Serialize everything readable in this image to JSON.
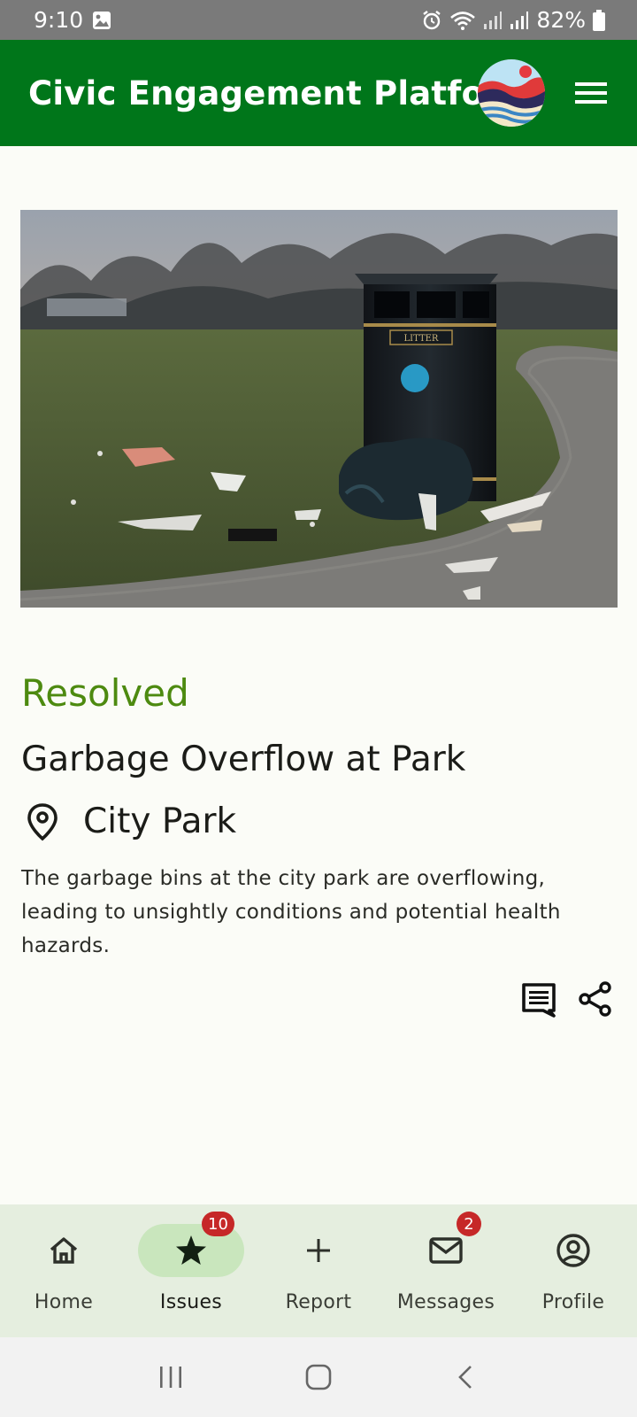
{
  "status_bar": {
    "time": "9:10",
    "battery": "82%"
  },
  "app_bar": {
    "title": "Civic Engagement Platform",
    "logo_icon": "app-logo",
    "menu_icon": "hamburger-menu-icon"
  },
  "issue": {
    "status": "Resolved",
    "title": "Garbage Overflow at Park",
    "location": "City Park",
    "description": "The garbage bins at the city park are overflowing, leading to unsightly conditions and potential health hazards.",
    "bin_label": "LITTER"
  },
  "bottom_nav": {
    "items": [
      {
        "label": "Home",
        "icon": "home-icon"
      },
      {
        "label": "Issues",
        "icon": "star-icon",
        "badge": "10"
      },
      {
        "label": "Report",
        "icon": "plus-icon"
      },
      {
        "label": "Messages",
        "icon": "mail-icon",
        "badge": "2"
      },
      {
        "label": "Profile",
        "icon": "account-circle-icon"
      }
    ]
  },
  "colors": {
    "app_bar": "#00761a",
    "status_resolved": "#4d8a10",
    "badge": "#c62828",
    "nav_background": "#e5eedf",
    "nav_active_pill": "#c9e6bd"
  }
}
